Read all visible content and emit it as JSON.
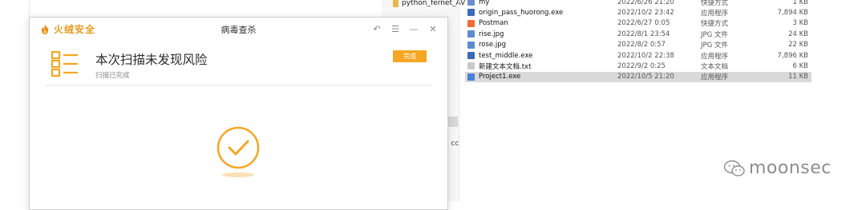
{
  "background": {
    "left_panel_item": "python_fernet_AV",
    "cut_text": ") cc",
    "files": [
      {
        "name": "my",
        "date": "2022/6/26 21:20",
        "type": "快捷方式",
        "size": "1 KB",
        "icon": "shortcut-icon",
        "color": "#6a8fd1"
      },
      {
        "name": "origin_pass_huorong.exe",
        "date": "2022/10/2 23:42",
        "type": "应用程序",
        "size": "7,894 KB",
        "icon": "exe-icon",
        "color": "#3a6ab8"
      },
      {
        "name": "Postman",
        "date": "2022/6/27 0:05",
        "type": "快捷方式",
        "size": "3 KB",
        "icon": "postman-icon",
        "color": "#ef6c35"
      },
      {
        "name": "rise.jpg",
        "date": "2022/8/1 23:54",
        "type": "JPG 文件",
        "size": "24 KB",
        "icon": "image-icon",
        "color": "#5b8ccf"
      },
      {
        "name": "rose.jpg",
        "date": "2022/8/2 0:57",
        "type": "JPG 文件",
        "size": "22 KB",
        "icon": "image-icon",
        "color": "#5b8ccf"
      },
      {
        "name": "test_middle.exe",
        "date": "2022/10/2 22:38",
        "type": "应用程序",
        "size": "7,896 KB",
        "icon": "exe-icon",
        "color": "#3a6ab8"
      },
      {
        "name": "新建文本文档.txt",
        "date": "2022/9/2 0:25",
        "type": "文本文档",
        "size": "6 KB",
        "icon": "text-file-icon",
        "color": "#c9c9c9"
      },
      {
        "name": "Project1.exe",
        "date": "2022/10/5 21:20",
        "type": "应用程序",
        "size": "11 KB",
        "icon": "app-icon",
        "color": "#4a7fd4"
      }
    ]
  },
  "dialog": {
    "brand": "火绒安全",
    "title": "病毒查杀",
    "window_controls": {
      "back": "↶",
      "menu": "☰",
      "minimize": "—",
      "close": "✕"
    },
    "result_title": "本次扫描未发现风险",
    "result_subtitle": "扫描已完成",
    "done_button": "完成",
    "accent_color": "#f5a623"
  },
  "watermark": {
    "text": "moonsec",
    "icon": "wechat-icon"
  }
}
